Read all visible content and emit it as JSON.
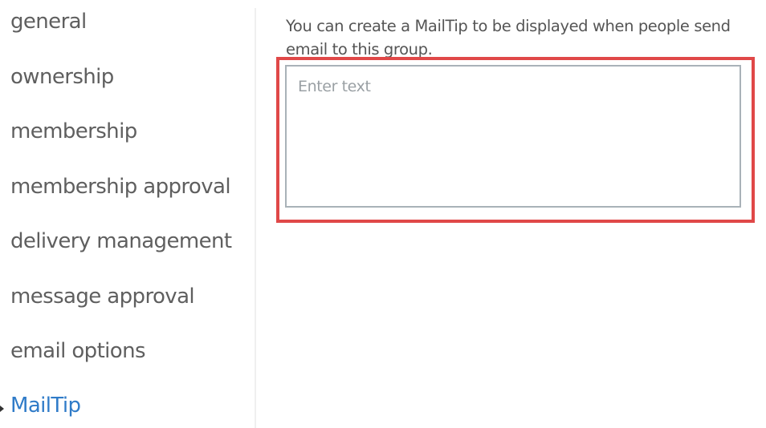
{
  "nav": {
    "items": [
      {
        "label": "general"
      },
      {
        "label": "ownership"
      },
      {
        "label": "membership"
      },
      {
        "label": "membership approval"
      },
      {
        "label": "delivery management"
      },
      {
        "label": "message approval"
      },
      {
        "label": "email options"
      },
      {
        "label": "MailTip"
      }
    ],
    "active_index": 7
  },
  "mailtip": {
    "description": "You can create a MailTip to be displayed when people send email to this group.",
    "textarea_placeholder": "Enter text",
    "textarea_value": ""
  },
  "colors": {
    "active_nav": "#2f7bc8",
    "highlight_border": "#e04848"
  }
}
